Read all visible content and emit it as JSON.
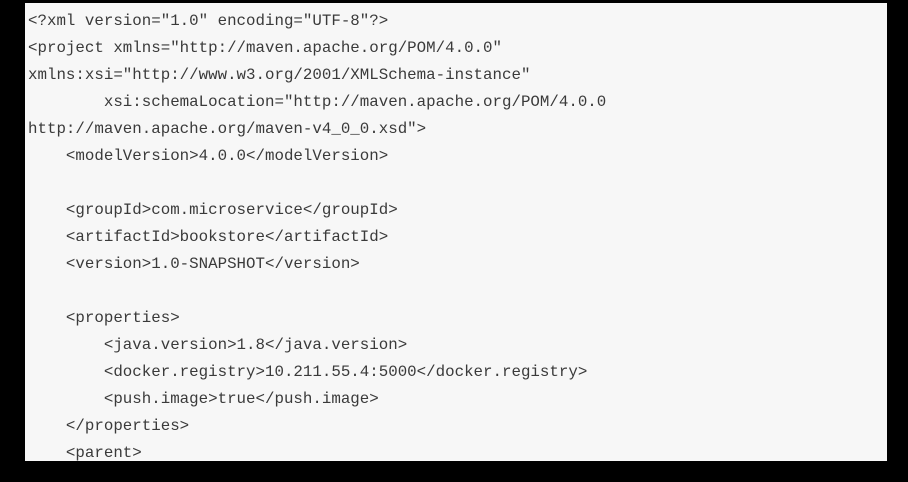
{
  "code": {
    "lines": [
      "<?xml version=\"1.0\" encoding=\"UTF-8\"?>",
      "<project xmlns=\"http://maven.apache.org/POM/4.0.0\"",
      "xmlns:xsi=\"http://www.w3.org/2001/XMLSchema-instance\"",
      "        xsi:schemaLocation=\"http://maven.apache.org/POM/4.0.0",
      "http://maven.apache.org/maven-v4_0_0.xsd\">",
      "    <modelVersion>4.0.0</modelVersion>",
      "",
      "    <groupId>com.microservice</groupId>",
      "    <artifactId>bookstore</artifactId>",
      "    <version>1.0-SNAPSHOT</version>",
      "",
      "    <properties>",
      "        <java.version>1.8</java.version>",
      "        <docker.registry>10.211.55.4:5000</docker.registry>",
      "        <push.image>true</push.image>",
      "    </properties>",
      "    <parent>"
    ]
  }
}
